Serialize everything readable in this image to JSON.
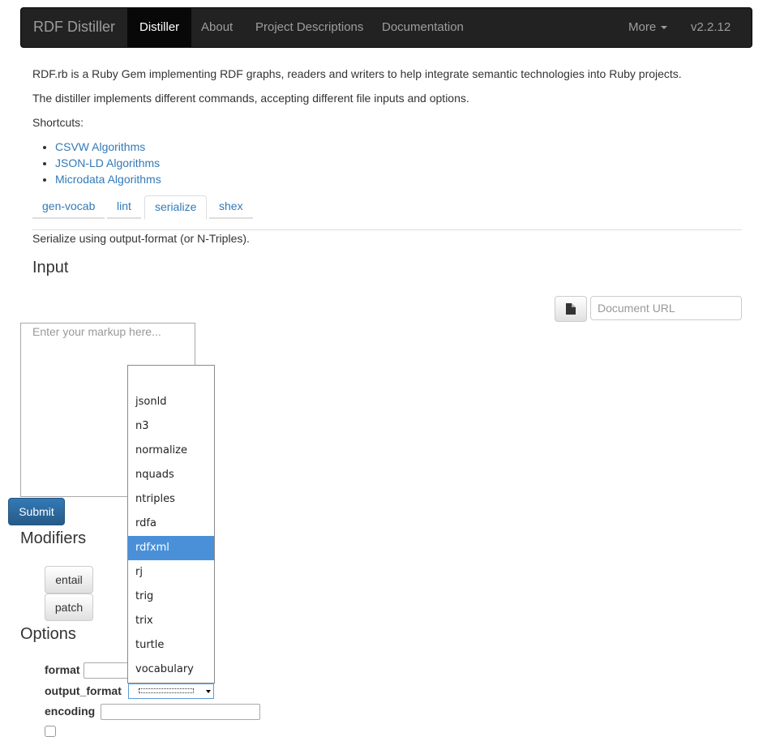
{
  "navbar": {
    "brand": "RDF Distiller",
    "items": [
      {
        "label": "Distiller",
        "active": true
      },
      {
        "label": "About",
        "active": false
      },
      {
        "label": "Project Descriptions",
        "active": false
      },
      {
        "label": "Documentation",
        "active": false
      }
    ],
    "more_label": "More",
    "version": "v2.2.12"
  },
  "intro": {
    "line1": "RDF.rb is a Ruby Gem implementing RDF graphs, readers and writers to help integrate semantic technologies into Ruby projects.",
    "line2": "The distiller implements different commands, accepting different file inputs and options.",
    "shortcuts_label": "Shortcuts:",
    "shortcuts": [
      "CSVW Algorithms",
      "JSON-LD Algorithms",
      "Microdata Algorithms"
    ]
  },
  "tabs": [
    "gen-vocab",
    "lint",
    "serialize",
    "shex"
  ],
  "active_tab": "serialize",
  "tab_description": "Serialize using output-format (or N-Triples).",
  "input": {
    "heading": "Input",
    "url_placeholder": "Document URL",
    "markup_placeholder": "Enter your markup here...",
    "submit_label": "Submit"
  },
  "modifiers": {
    "heading": "Modifiers",
    "buttons": [
      "entail",
      "patch"
    ]
  },
  "options": {
    "heading": "Options",
    "format_label": "format",
    "output_format_label": "output_format",
    "encoding_label": "encoding",
    "output_format_options": [
      "",
      "jsonld",
      "n3",
      "normalize",
      "nquads",
      "ntriples",
      "rdfa",
      "rdfxml",
      "rj",
      "trig",
      "trix",
      "turtle",
      "vocabulary"
    ],
    "highlighted_option": "rdfxml"
  },
  "colors": {
    "navbar_bg": "#222222",
    "link": "#337ab7",
    "primary": "#337ab7",
    "dropdown_highlight": "#4a90d9"
  }
}
